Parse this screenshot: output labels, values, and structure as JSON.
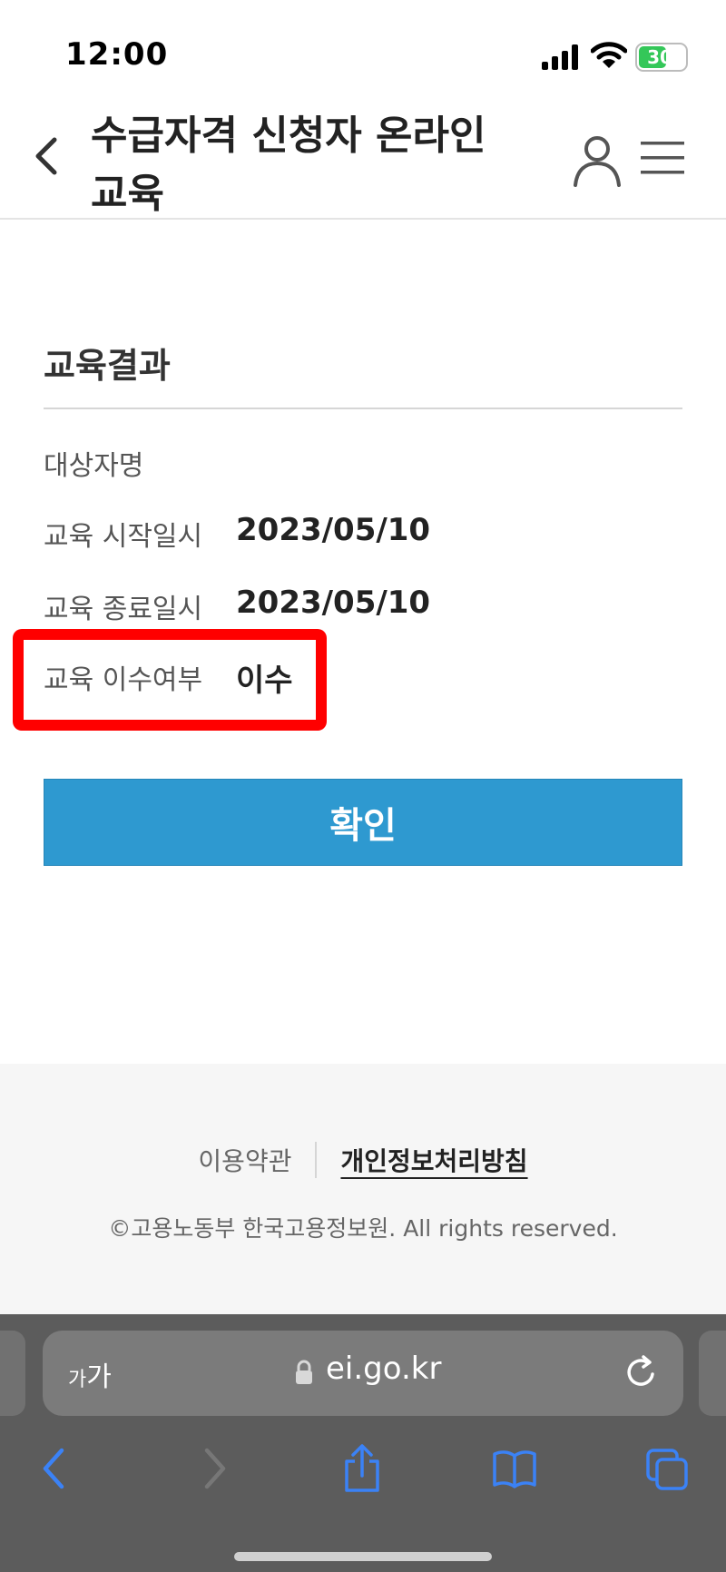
{
  "status_bar": {
    "time": "12:00",
    "battery": "30"
  },
  "header": {
    "title": "수급자격 신청자 온라인 교육"
  },
  "result": {
    "section_title": "교육결과",
    "rows": [
      {
        "label": "대상자명",
        "value": ""
      },
      {
        "label": "교육 시작일시",
        "value": "2023/05/10"
      },
      {
        "label": "교육 종료일시",
        "value": "2023/05/10"
      },
      {
        "label": "교육 이수여부",
        "value": "이수"
      }
    ],
    "confirm_label": "확인"
  },
  "footer": {
    "terms_label": "이용약관",
    "privacy_label": "개인정보처리방침",
    "copyright": "©고용노동부 한국고용정보원. All rights reserved."
  },
  "browser": {
    "text_size_small": "가",
    "text_size_large": "가",
    "url": "ei.go.kr"
  },
  "colors": {
    "primary_button": "#2e99d0",
    "highlight": "#ff0000",
    "browser_accent": "#3b82f6"
  }
}
